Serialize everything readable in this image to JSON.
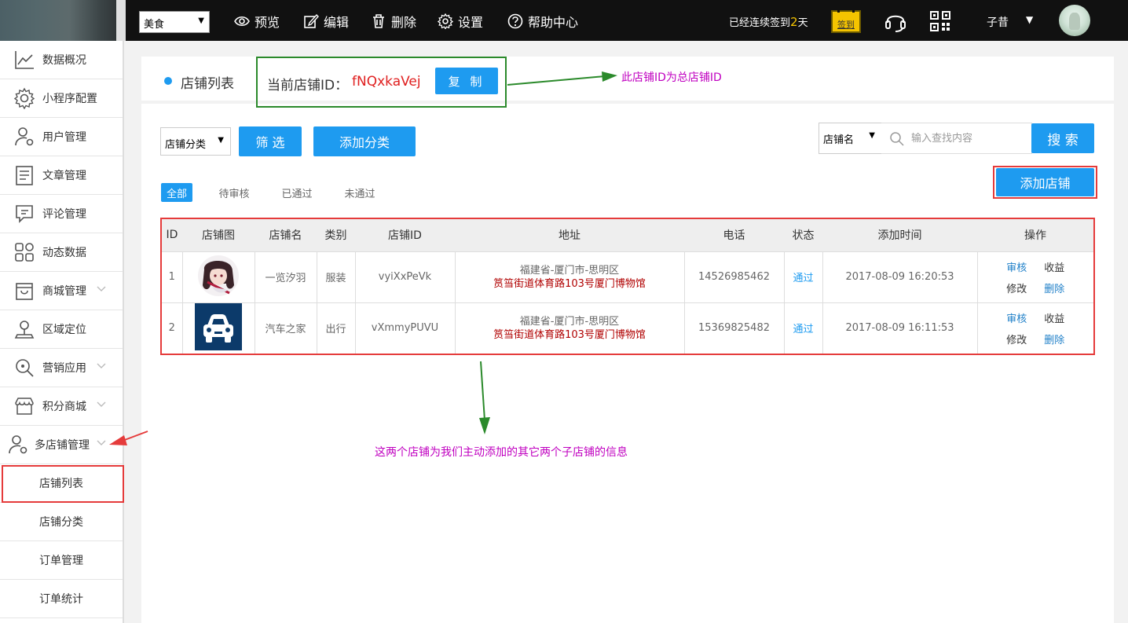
{
  "topbar": {
    "category_select": "美食",
    "menu": [
      {
        "label": "预览",
        "icon": "eye-icon"
      },
      {
        "label": "编辑",
        "icon": "edit-icon"
      },
      {
        "label": "删除",
        "icon": "trash-icon"
      },
      {
        "label": "设置",
        "icon": "gear-icon"
      },
      {
        "label": "帮助中心",
        "icon": "help-icon"
      }
    ],
    "sign_prefix": "已经连续签到",
    "sign_days": "2",
    "sign_suffix": "天",
    "sign_button": "签到",
    "username": "子昔"
  },
  "sidebar": {
    "items": [
      {
        "label": "数据概况",
        "icon": "chart-line-icon"
      },
      {
        "label": "小程序配置",
        "icon": "gear-icon"
      },
      {
        "label": "用户管理",
        "icon": "user-gear-icon"
      },
      {
        "label": "文章管理",
        "icon": "article-icon"
      },
      {
        "label": "评论管理",
        "icon": "comment-icon"
      },
      {
        "label": "动态数据",
        "icon": "grid-icon"
      },
      {
        "label": "商城管理",
        "icon": "shop-bag-icon"
      },
      {
        "label": "区域定位",
        "icon": "location-icon"
      },
      {
        "label": "营销应用",
        "icon": "search-tag-icon"
      },
      {
        "label": "积分商城",
        "icon": "store-icon"
      },
      {
        "label": "多店铺管理",
        "icon": "multi-shop-icon"
      }
    ],
    "sub_items": [
      {
        "label": "店铺列表"
      },
      {
        "label": "店铺分类"
      },
      {
        "label": "订单管理"
      },
      {
        "label": "订单统计"
      }
    ]
  },
  "header": {
    "title": "店铺列表",
    "current_id_label": "当前店铺ID：",
    "current_id_value": "fNQxkaVej",
    "copy_button": "复 制"
  },
  "toolbar": {
    "category_filter": "店铺分类",
    "filter_button": "筛 选",
    "add_category_button": "添加分类",
    "search_field_select": "店铺名",
    "search_placeholder": "输入查找内容",
    "search_button": "搜 索",
    "add_shop_button": "添加店铺"
  },
  "filter_tabs": [
    {
      "label": "全部",
      "active": true
    },
    {
      "label": "待审核"
    },
    {
      "label": "已通过"
    },
    {
      "label": "未通过"
    }
  ],
  "table": {
    "columns": [
      "ID",
      "店铺图",
      "店铺名",
      "类别",
      "店铺ID",
      "地址",
      "电话",
      "状态",
      "添加时间",
      "操作"
    ],
    "rows": [
      {
        "id": "1",
        "image": "anime-girl-avatar",
        "name": "一览汐羽",
        "category": "服装",
        "shop_id": "vyiXxPeVk",
        "address_line1": "福建省-厦门市-思明区",
        "address_line2": "筼筜街道体育路103号厦门博物馆",
        "phone": "14526985462",
        "status": "通过",
        "added": "2017-08-09 16:20:53",
        "ops": [
          "审核",
          "收益",
          "修改",
          "删除"
        ]
      },
      {
        "id": "2",
        "image": "car-icon",
        "name": "汽车之家",
        "category": "出行",
        "shop_id": "vXmmyPUVU",
        "address_line1": "福建省-厦门市-思明区",
        "address_line2": "筼筜街道体育路103号厦门博物馆",
        "phone": "15369825482",
        "status": "通过",
        "added": "2017-08-09 16:11:53",
        "ops": [
          "审核",
          "收益",
          "修改",
          "删除"
        ]
      }
    ]
  },
  "annotations": {
    "total_id_note": "此店铺ID为总店铺ID",
    "child_shops_note": "这两个店铺为我们主动添加的其它两个子店铺的信息"
  },
  "colors": {
    "accent": "#1e9bf0",
    "highlight_red": "#e53b3b",
    "highlight_green": "#2b8a2b",
    "annotation": "#c000c0",
    "sign_badge": "#f5c400"
  }
}
